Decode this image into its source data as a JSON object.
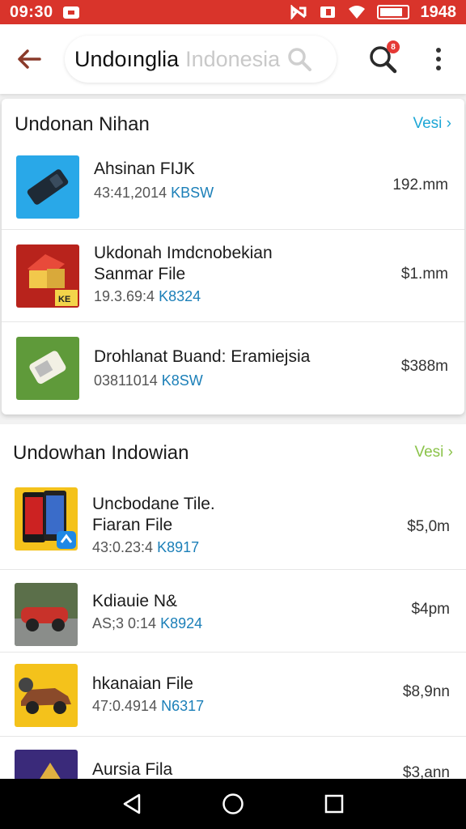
{
  "status_bar": {
    "time": "09:30",
    "clock_right": "1948",
    "battery_level": 0.85,
    "bg_color": "#d9342b"
  },
  "app_bar": {
    "search_query": "Undoıngliа",
    "search_placeholder": "Indonesia",
    "notification_badge": "8"
  },
  "section1": {
    "title": "Undonan Nihan",
    "view_all": "Vesi ›",
    "items": [
      {
        "title_lines": [
          "Ahsinan FIJK"
        ],
        "meta_prefix": "43:41,2014 ",
        "meta_code": "KBSW",
        "size": "192.mm",
        "thumb": "phone-blue"
      },
      {
        "title_lines": [
          "Ukdonah Imdcnobekian",
          "Sanmar File"
        ],
        "meta_prefix": "19.3.69:4 ",
        "meta_code": "K8324",
        "size": "$1.mm",
        "thumb": "house-red"
      },
      {
        "title_lines": [
          "Drohlanat Buand: Eramiejsia"
        ],
        "meta_prefix": "03811014 ",
        "meta_code": "K8SW",
        "size": "$388m",
        "thumb": "phone-green"
      }
    ]
  },
  "section2": {
    "title": "Undowhan Indowian",
    "view_all": "Vesi ›",
    "items": [
      {
        "title_lines": [
          "Uncbodane Tile.",
          "Fiaran File"
        ],
        "meta_prefix": "43:0.23:4 ",
        "meta_code": "K8917",
        "size": "$5,0m",
        "thumb": "phones-yellow"
      },
      {
        "title_lines": [
          "Kdiauie N&"
        ],
        "meta_prefix": "AS;3 0:14 ",
        "meta_code": "K8924",
        "size": "$4pm",
        "thumb": "car-red"
      },
      {
        "title_lines": [
          "hkanaian File"
        ],
        "meta_prefix": "47:0.4914 ",
        "meta_code": "N6317",
        "size": "$8,9nn",
        "thumb": "car-yellow"
      },
      {
        "title_lines": [
          "Aursia Fila"
        ],
        "meta_prefix": "",
        "meta_code": "",
        "size": "$3,ann",
        "thumb": "purple"
      }
    ]
  },
  "colors": {
    "accent_blue": "#1ea7d6",
    "accent_green": "#8bc34a",
    "code_blue": "#1b7fb8"
  },
  "icons": [
    "back-arrow-icon",
    "search-icon",
    "more-vert-icon",
    "nav-back-icon",
    "nav-home-icon",
    "nav-recents-icon",
    "wifi-icon",
    "battery-icon"
  ]
}
